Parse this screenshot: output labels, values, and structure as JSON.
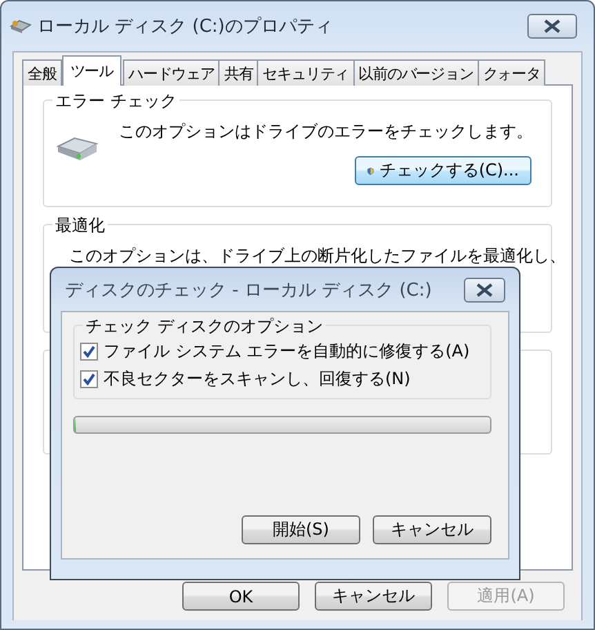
{
  "window": {
    "title": "ローカル ディスク (C:)のプロパティ"
  },
  "tabs": [
    {
      "label": "全般",
      "selected": false
    },
    {
      "label": "ツール",
      "selected": true
    },
    {
      "label": "ハードウェア",
      "selected": false
    },
    {
      "label": "共有",
      "selected": false
    },
    {
      "label": "セキュリティ",
      "selected": false
    },
    {
      "label": "以前のバージョン",
      "selected": false
    },
    {
      "label": "クォータ",
      "selected": false
    }
  ],
  "error_check": {
    "title": "エラー チェック",
    "description": "このオプションはドライブのエラーをチェックします。",
    "button": "チェックする(C)..."
  },
  "optimize": {
    "title": "最適化",
    "description": "このオプションは、ドライブ上の断片化したファイルを最適化し、"
  },
  "dialog": {
    "title": "ディスクのチェック - ローカル ディスク (C:)",
    "group_title": "チェック ディスクのオプション",
    "options": [
      {
        "label": "ファイル システム エラーを自動的に修復する(A)",
        "checked": true
      },
      {
        "label": "不良セクターをスキャンし、回復する(N)",
        "checked": true
      }
    ],
    "progress": {
      "level": 0
    },
    "buttons": [
      "開始(S)",
      "キャンセル"
    ]
  },
  "buttons": [
    {
      "label": "OK",
      "disabled": false
    },
    {
      "label": "キャンセル",
      "disabled": false
    },
    {
      "label": "適用(A)",
      "disabled": true
    }
  ]
}
